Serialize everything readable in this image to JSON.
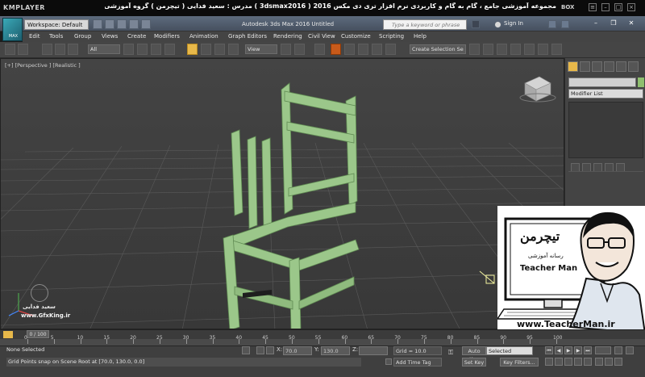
{
  "player": {
    "logo": "KMPLAYER",
    "title": "مجموعه آموزشی جامع ، گام به گام و کاربردی نرم افزار تری دی مکس 2016 ( 3dsmax2016 )  مدرس : سعید فدایی ( تیچرمن ) گروه آموزشی پادشاه گرافیست ها",
    "box_label": "BOX"
  },
  "titlebar": {
    "workspace": "Workspace: Default",
    "app_title": "Autodesk 3ds Max 2016    Untitled",
    "search_placeholder": "Type a keyword or phrase",
    "sign_in": "Sign In",
    "max_label": "MAX"
  },
  "menu": [
    "Edit",
    "Tools",
    "Group",
    "Views",
    "Create",
    "Modifiers",
    "Animation",
    "Graph Editors",
    "Rendering",
    "Civil View",
    "Customize",
    "Scripting",
    "Help"
  ],
  "toolbar": {
    "filter": "All",
    "coord_system": "View",
    "selection_set": "Create Selection Se"
  },
  "viewport": {
    "label": "[+] [Perspective ] [Realistic ]"
  },
  "command_panel": {
    "modifier_list": "Modifier List",
    "object_color": "#8fbf6f"
  },
  "overlay": {
    "brand_fa": "تیچرمن",
    "brand_sub_fa": "رسانه آموزشی",
    "brand_en": "Teacher Man",
    "website": "www.TeacherMan.ir",
    "watermark_name": "سعید فدایی",
    "watermark_site": "www.GfxKing.ir"
  },
  "timeline": {
    "frame": "0 / 100",
    "ticks": [
      "0",
      "5",
      "10",
      "15",
      "20",
      "25",
      "30",
      "35",
      "40",
      "45",
      "50",
      "55",
      "60",
      "65",
      "70",
      "75",
      "80",
      "85",
      "90",
      "95",
      "100"
    ]
  },
  "status": {
    "selection": "None Selected",
    "prompt": "Grid Points snap on Scene Root at [70.0, 130.0, 0.0]",
    "x_label": "X:",
    "x_value": "70.0",
    "y_label": "Y:",
    "y_value": "130.0",
    "z_label": "Z:",
    "grid": "Grid = 10.0",
    "add_time_tag": "Add Time Tag",
    "auto_key": "Auto Key",
    "set_key": "Set Key",
    "key_mode": "Selected",
    "key_filters": "Key Filters..."
  }
}
